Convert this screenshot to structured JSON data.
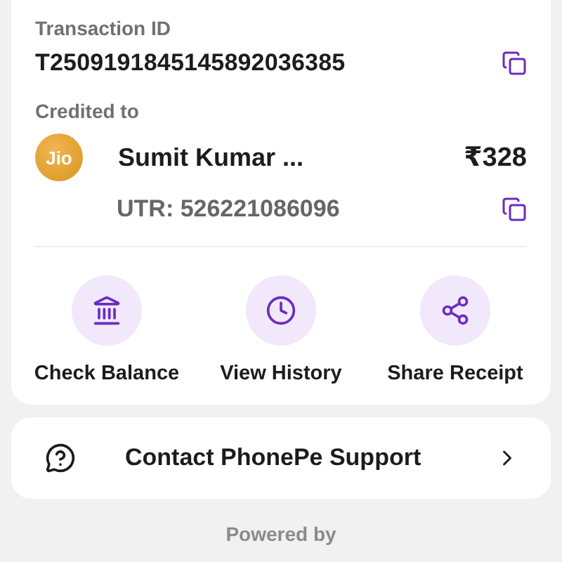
{
  "transaction": {
    "id_label": "Transaction ID",
    "id": "T2509191845145892036385",
    "credited_label": "Credited to",
    "logo_text": "Jio",
    "name": "Sumit Kumar ...",
    "amount": "₹328",
    "utr": "UTR: 526221086096"
  },
  "actions": [
    {
      "kind": "bank",
      "label": "Check Balance"
    },
    {
      "kind": "history",
      "label": "View History"
    },
    {
      "kind": "share",
      "label": "Share Receipt"
    }
  ],
  "support": {
    "label": "Contact PhonePe Support"
  },
  "footer": "Powered by"
}
